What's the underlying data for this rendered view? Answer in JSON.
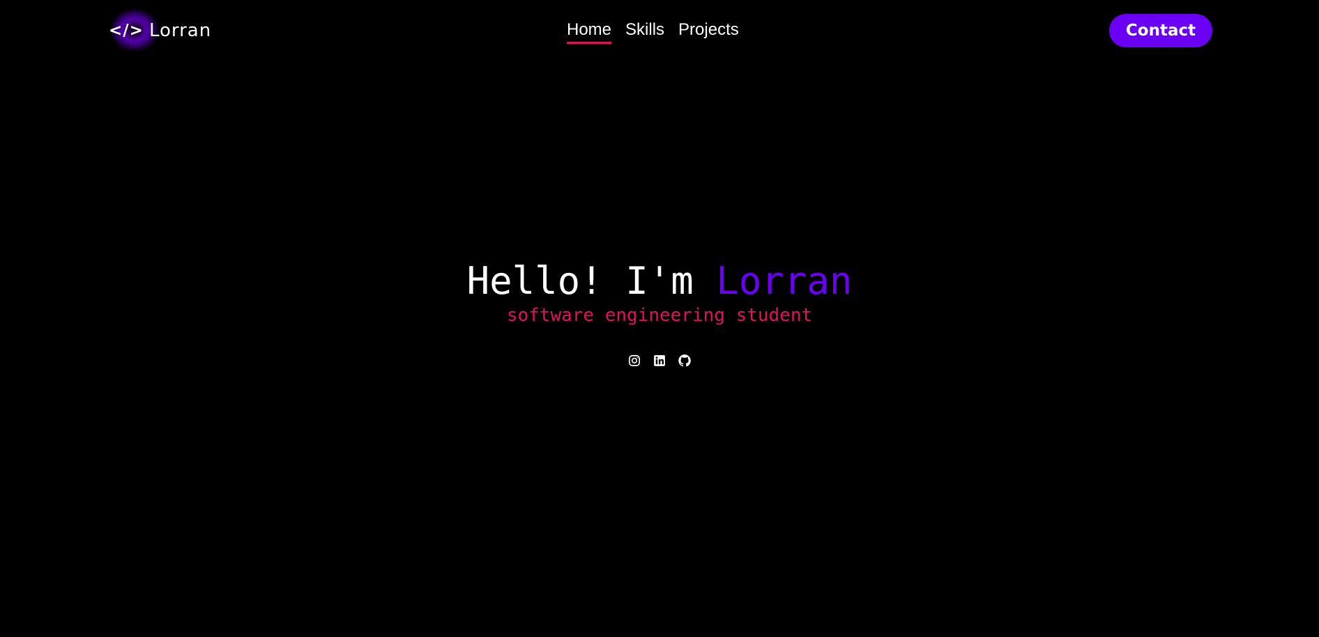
{
  "header": {
    "logo": {
      "code_symbol": "</>",
      "name": "Lorran"
    },
    "nav": [
      {
        "label": "Home",
        "active": true
      },
      {
        "label": "Skills",
        "active": false
      },
      {
        "label": "Projects",
        "active": false
      }
    ],
    "contact_label": "Contact"
  },
  "hero": {
    "greeting": "Hello! I'm ",
    "name": "Lorran",
    "subtitle": "software engineering student"
  },
  "socials": [
    {
      "icon": "instagram-icon"
    },
    {
      "icon": "linkedin-icon"
    },
    {
      "icon": "github-icon"
    }
  ],
  "colors": {
    "background": "#000000",
    "accent_purple": "#6a00f4",
    "accent_pink": "#e0115f",
    "text": "#ffffff"
  }
}
